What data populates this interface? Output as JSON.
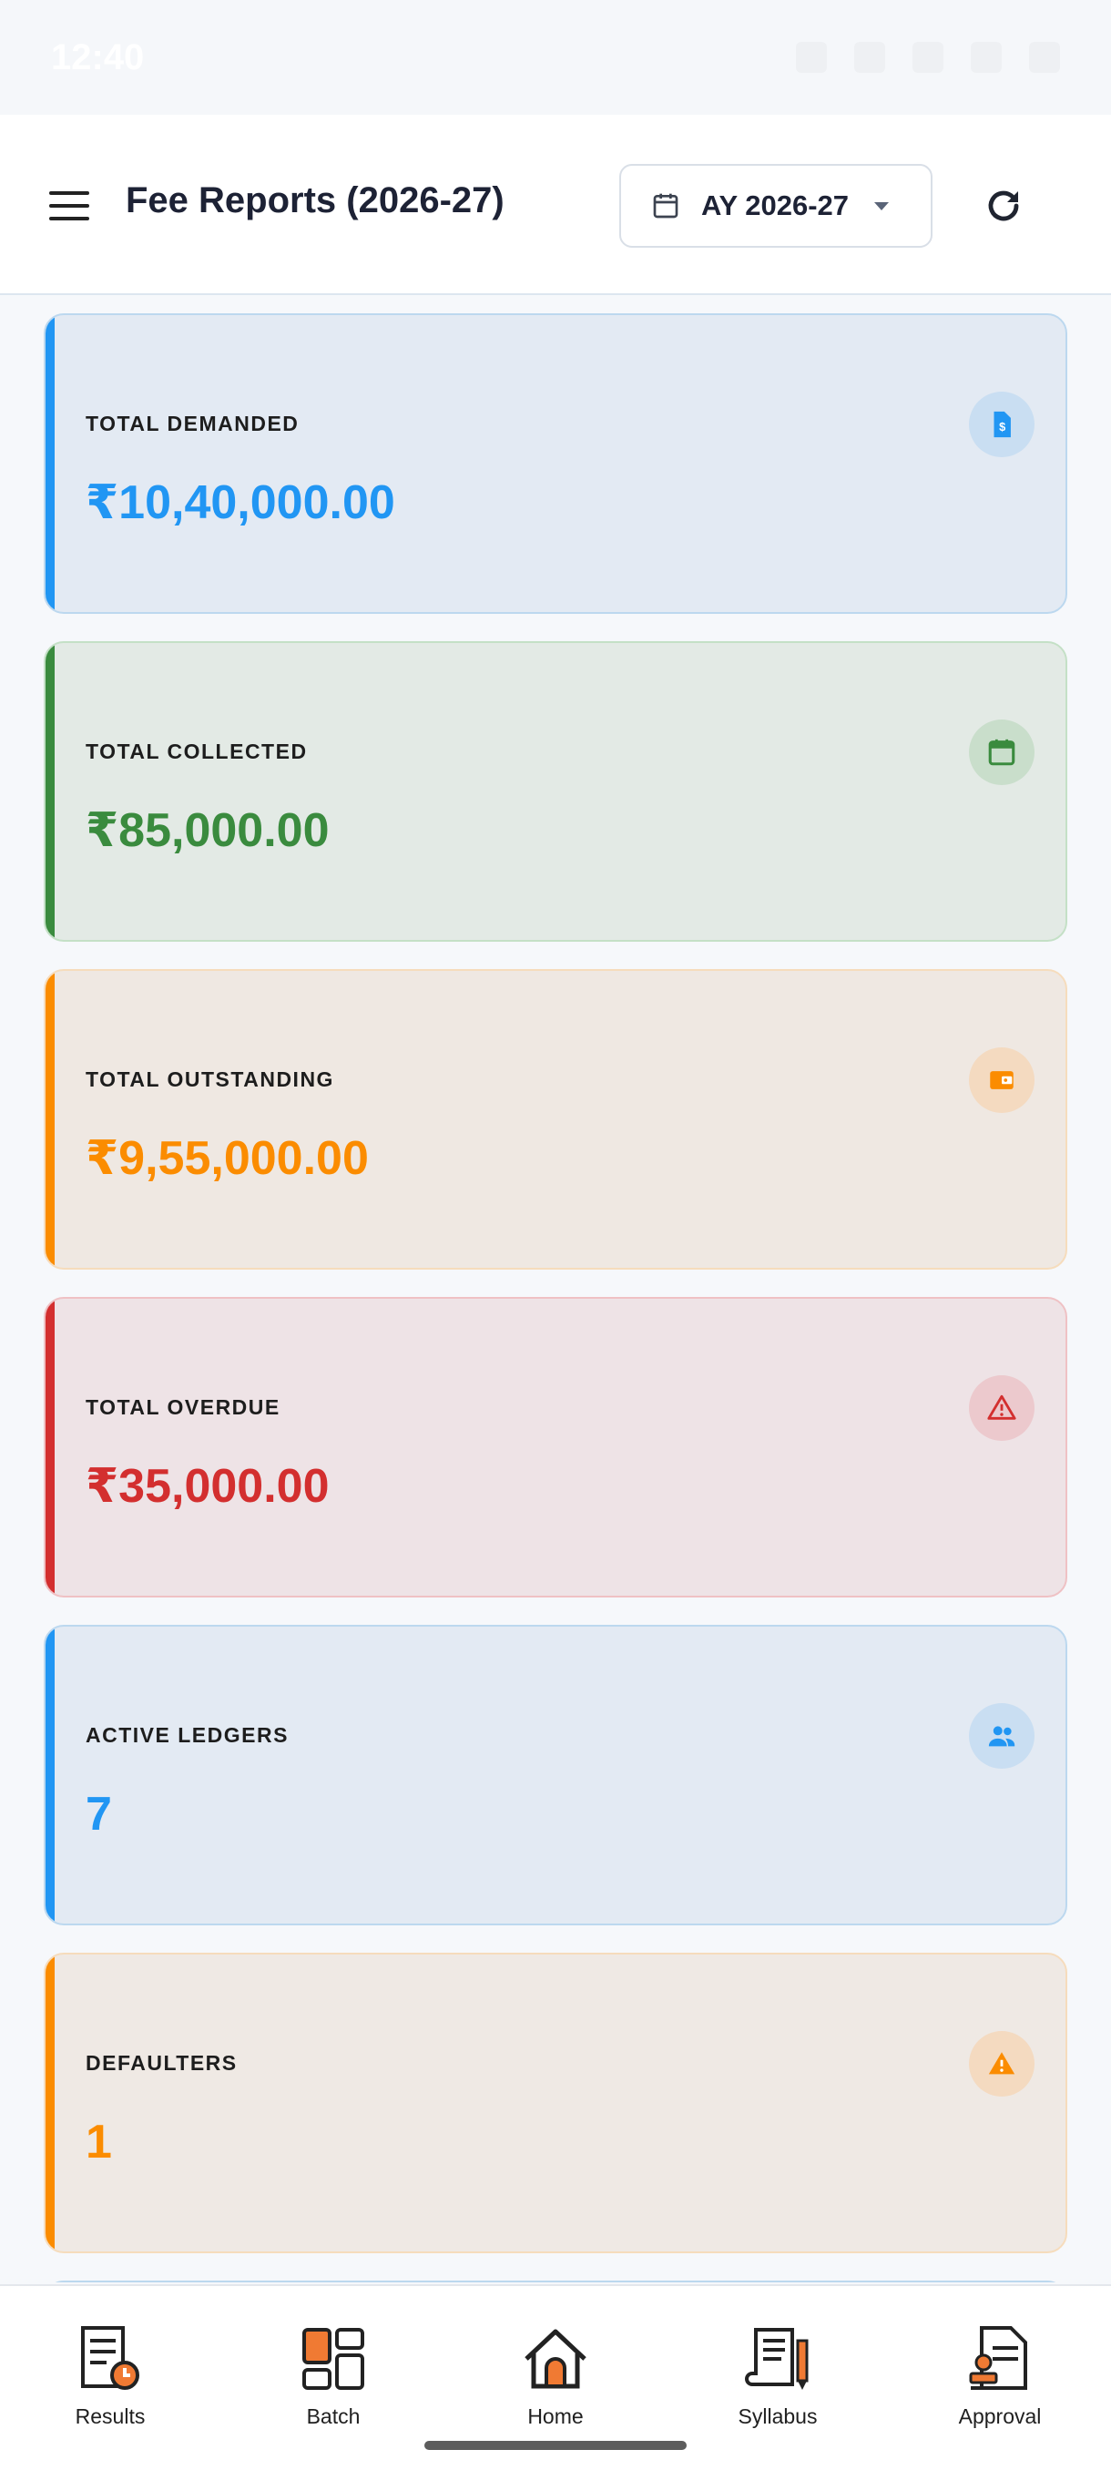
{
  "status_bar": {
    "time": "12:40"
  },
  "header": {
    "title": "Fee Reports (2026-27)",
    "academic_year": "AY 2026-27"
  },
  "cards": [
    {
      "label": "TOTAL DEMANDED",
      "value": "₹10,40,000.00",
      "icon": "invoice-icon",
      "accent": "#2196f3",
      "background": "#e3eaf3",
      "border": "#bcd8ef",
      "icon_bg": "#c9def2"
    },
    {
      "label": "TOTAL COLLECTED",
      "value": "₹85,000.00",
      "icon": "calendar-icon",
      "accent": "#3a8b3e",
      "background": "#e3eae5",
      "border": "#c4e0c6",
      "icon_bg": "#c9decb"
    },
    {
      "label": "TOTAL OUTSTANDING",
      "value": "₹9,55,000.00",
      "icon": "wallet-icon",
      "accent": "#fb8c00",
      "background": "#efe8e2",
      "border": "#f6dcbc",
      "icon_bg": "#f4dac0"
    },
    {
      "label": "TOTAL OVERDUE",
      "value": "₹35,000.00",
      "icon": "warning-outline-icon",
      "accent": "#d32f2f",
      "background": "#eee3e6",
      "border": "#efc1c4",
      "icon_bg": "#ecc9cd"
    },
    {
      "label": "ACTIVE LEDGERS",
      "value": "7",
      "icon": "people-icon",
      "accent": "#2196f3",
      "background": "#e3eaf3",
      "border": "#bcd8ef",
      "icon_bg": "#c9def2"
    },
    {
      "label": "DEFAULTERS",
      "value": "1",
      "icon": "warning-filled-icon",
      "accent": "#fb8c00",
      "background": "#efe9e4",
      "border": "#f6dcbc",
      "icon_bg": "#f4dac0"
    }
  ],
  "bottom_nav": [
    {
      "label": "Results",
      "icon": "results-icon"
    },
    {
      "label": "Batch",
      "icon": "batch-icon"
    },
    {
      "label": "Home",
      "icon": "home-icon"
    },
    {
      "label": "Syllabus",
      "icon": "syllabus-icon"
    },
    {
      "label": "Approval",
      "icon": "approval-icon"
    }
  ]
}
